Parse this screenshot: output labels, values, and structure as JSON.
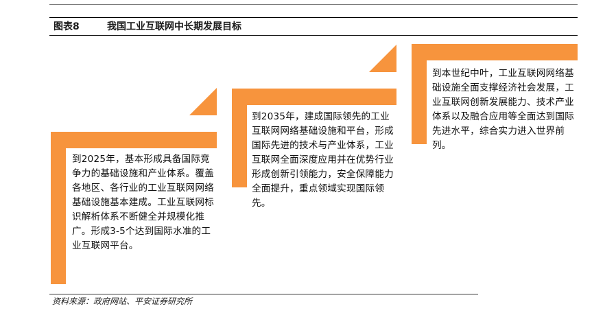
{
  "figure": {
    "label": "图表8",
    "title": "我国工业互联网中长期发展目标"
  },
  "stages": [
    {
      "text": "到2025年，基本形成具备国际竞争力的基础设施和产业体系。覆盖各地区、各行业的工业互联网网络基础设施基本建成。工业互联网标识解析体系不断健全并规模化推广。形成3-5个达到国际水准的工业互联网平台。"
    },
    {
      "text": "到2035年，建成国际领先的工业互联网网络基础设施和平台，形成国际先进的技术与产业体系，工业互联网全面深度应用并在优势行业形成创新引领能力，安全保障能力全面提升，重点领域实现国际领先。"
    },
    {
      "text": "到本世纪中叶，工业互联网网络基础设施全面支撑经济社会发展，工业互联网创新发展能力、技术产业体系以及融合应用等全面达到国际先进水平，综合实力进入世界前列。"
    }
  ],
  "source": "资料来源：政府网站、平安证券研究所",
  "colors": {
    "accent": "#F7943D",
    "text": "#111111",
    "rule": "#000000"
  }
}
